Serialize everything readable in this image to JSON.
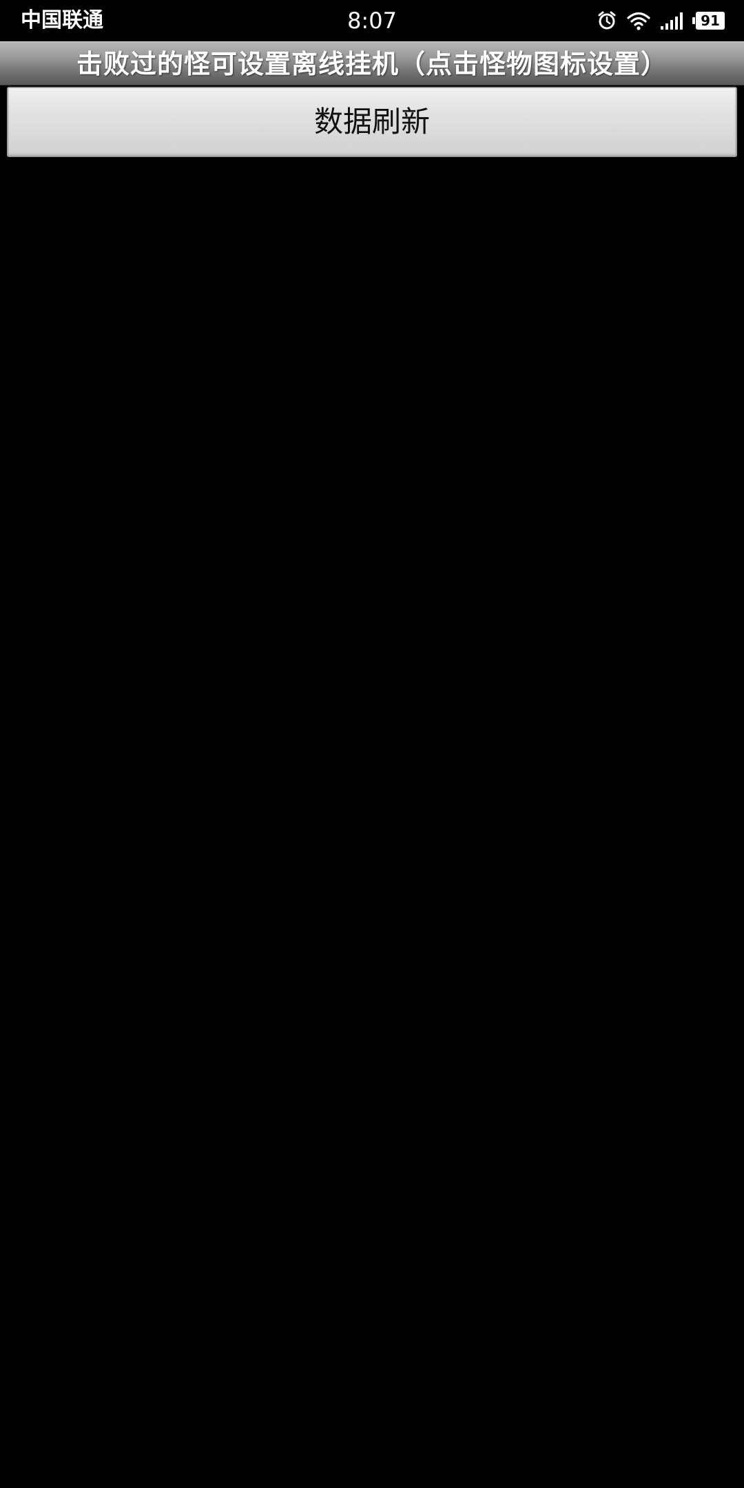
{
  "status_bar": {
    "carrier": "中国联通",
    "time": "8:07",
    "battery_level": "91",
    "icons": [
      "alarm-clock-icon",
      "wifi-icon",
      "signal-icon",
      "battery-icon"
    ]
  },
  "header": {
    "title": "击败过的怪可设置离线挂机（点击怪物图标设置）"
  },
  "main": {
    "refresh_button_label": "数据刷新"
  },
  "colors": {
    "background": "#000000",
    "title_bar_top": "#b8b8b8",
    "title_bar_bottom": "#585858",
    "button_face": "#e0e0e0",
    "button_text": "#111111"
  }
}
